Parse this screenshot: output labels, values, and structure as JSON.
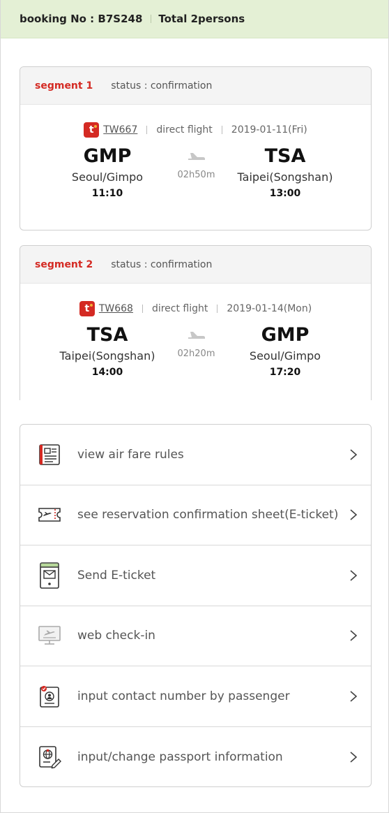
{
  "header": {
    "booking_label": "booking No : B7S248",
    "total_label": "Total 2persons"
  },
  "segments": [
    {
      "title": "segment 1",
      "status": "status : confirmation",
      "airline_logo": "t",
      "flight_no": "TW667",
      "flight_type": "direct flight",
      "date": "2019-01-11(Fri)",
      "departure": {
        "code": "GMP",
        "city": "Seoul/Gimpo",
        "time": "11:10"
      },
      "arrival": {
        "code": "TSA",
        "city": "Taipei(Songshan)",
        "time": "13:00"
      },
      "duration": "02h50m"
    },
    {
      "title": "segment 2",
      "status": "status : confirmation",
      "airline_logo": "t",
      "flight_no": "TW668",
      "flight_type": "direct flight",
      "date": "2019-01-14(Mon)",
      "departure": {
        "code": "TSA",
        "city": "Taipei(Songshan)",
        "time": "14:00"
      },
      "arrival": {
        "code": "GMP",
        "city": "Seoul/Gimpo",
        "time": "17:20"
      },
      "duration": "02h20m"
    }
  ],
  "menu": [
    {
      "label": "view air fare rules",
      "icon": "document-icon"
    },
    {
      "label": "see reservation confirmation sheet(E-ticket)",
      "icon": "ticket-icon"
    },
    {
      "label": "Send E-ticket",
      "icon": "email-device-icon"
    },
    {
      "label": "web check-in",
      "icon": "monitor-plane-icon"
    },
    {
      "label": "input contact number by passenger",
      "icon": "contact-badge-icon"
    },
    {
      "label": "input/change passport information",
      "icon": "passport-edit-icon"
    }
  ],
  "colors": {
    "header_bg": "#e4f0d5",
    "accent_red": "#d42a23",
    "segment_head_bg": "#f4f4f4"
  }
}
